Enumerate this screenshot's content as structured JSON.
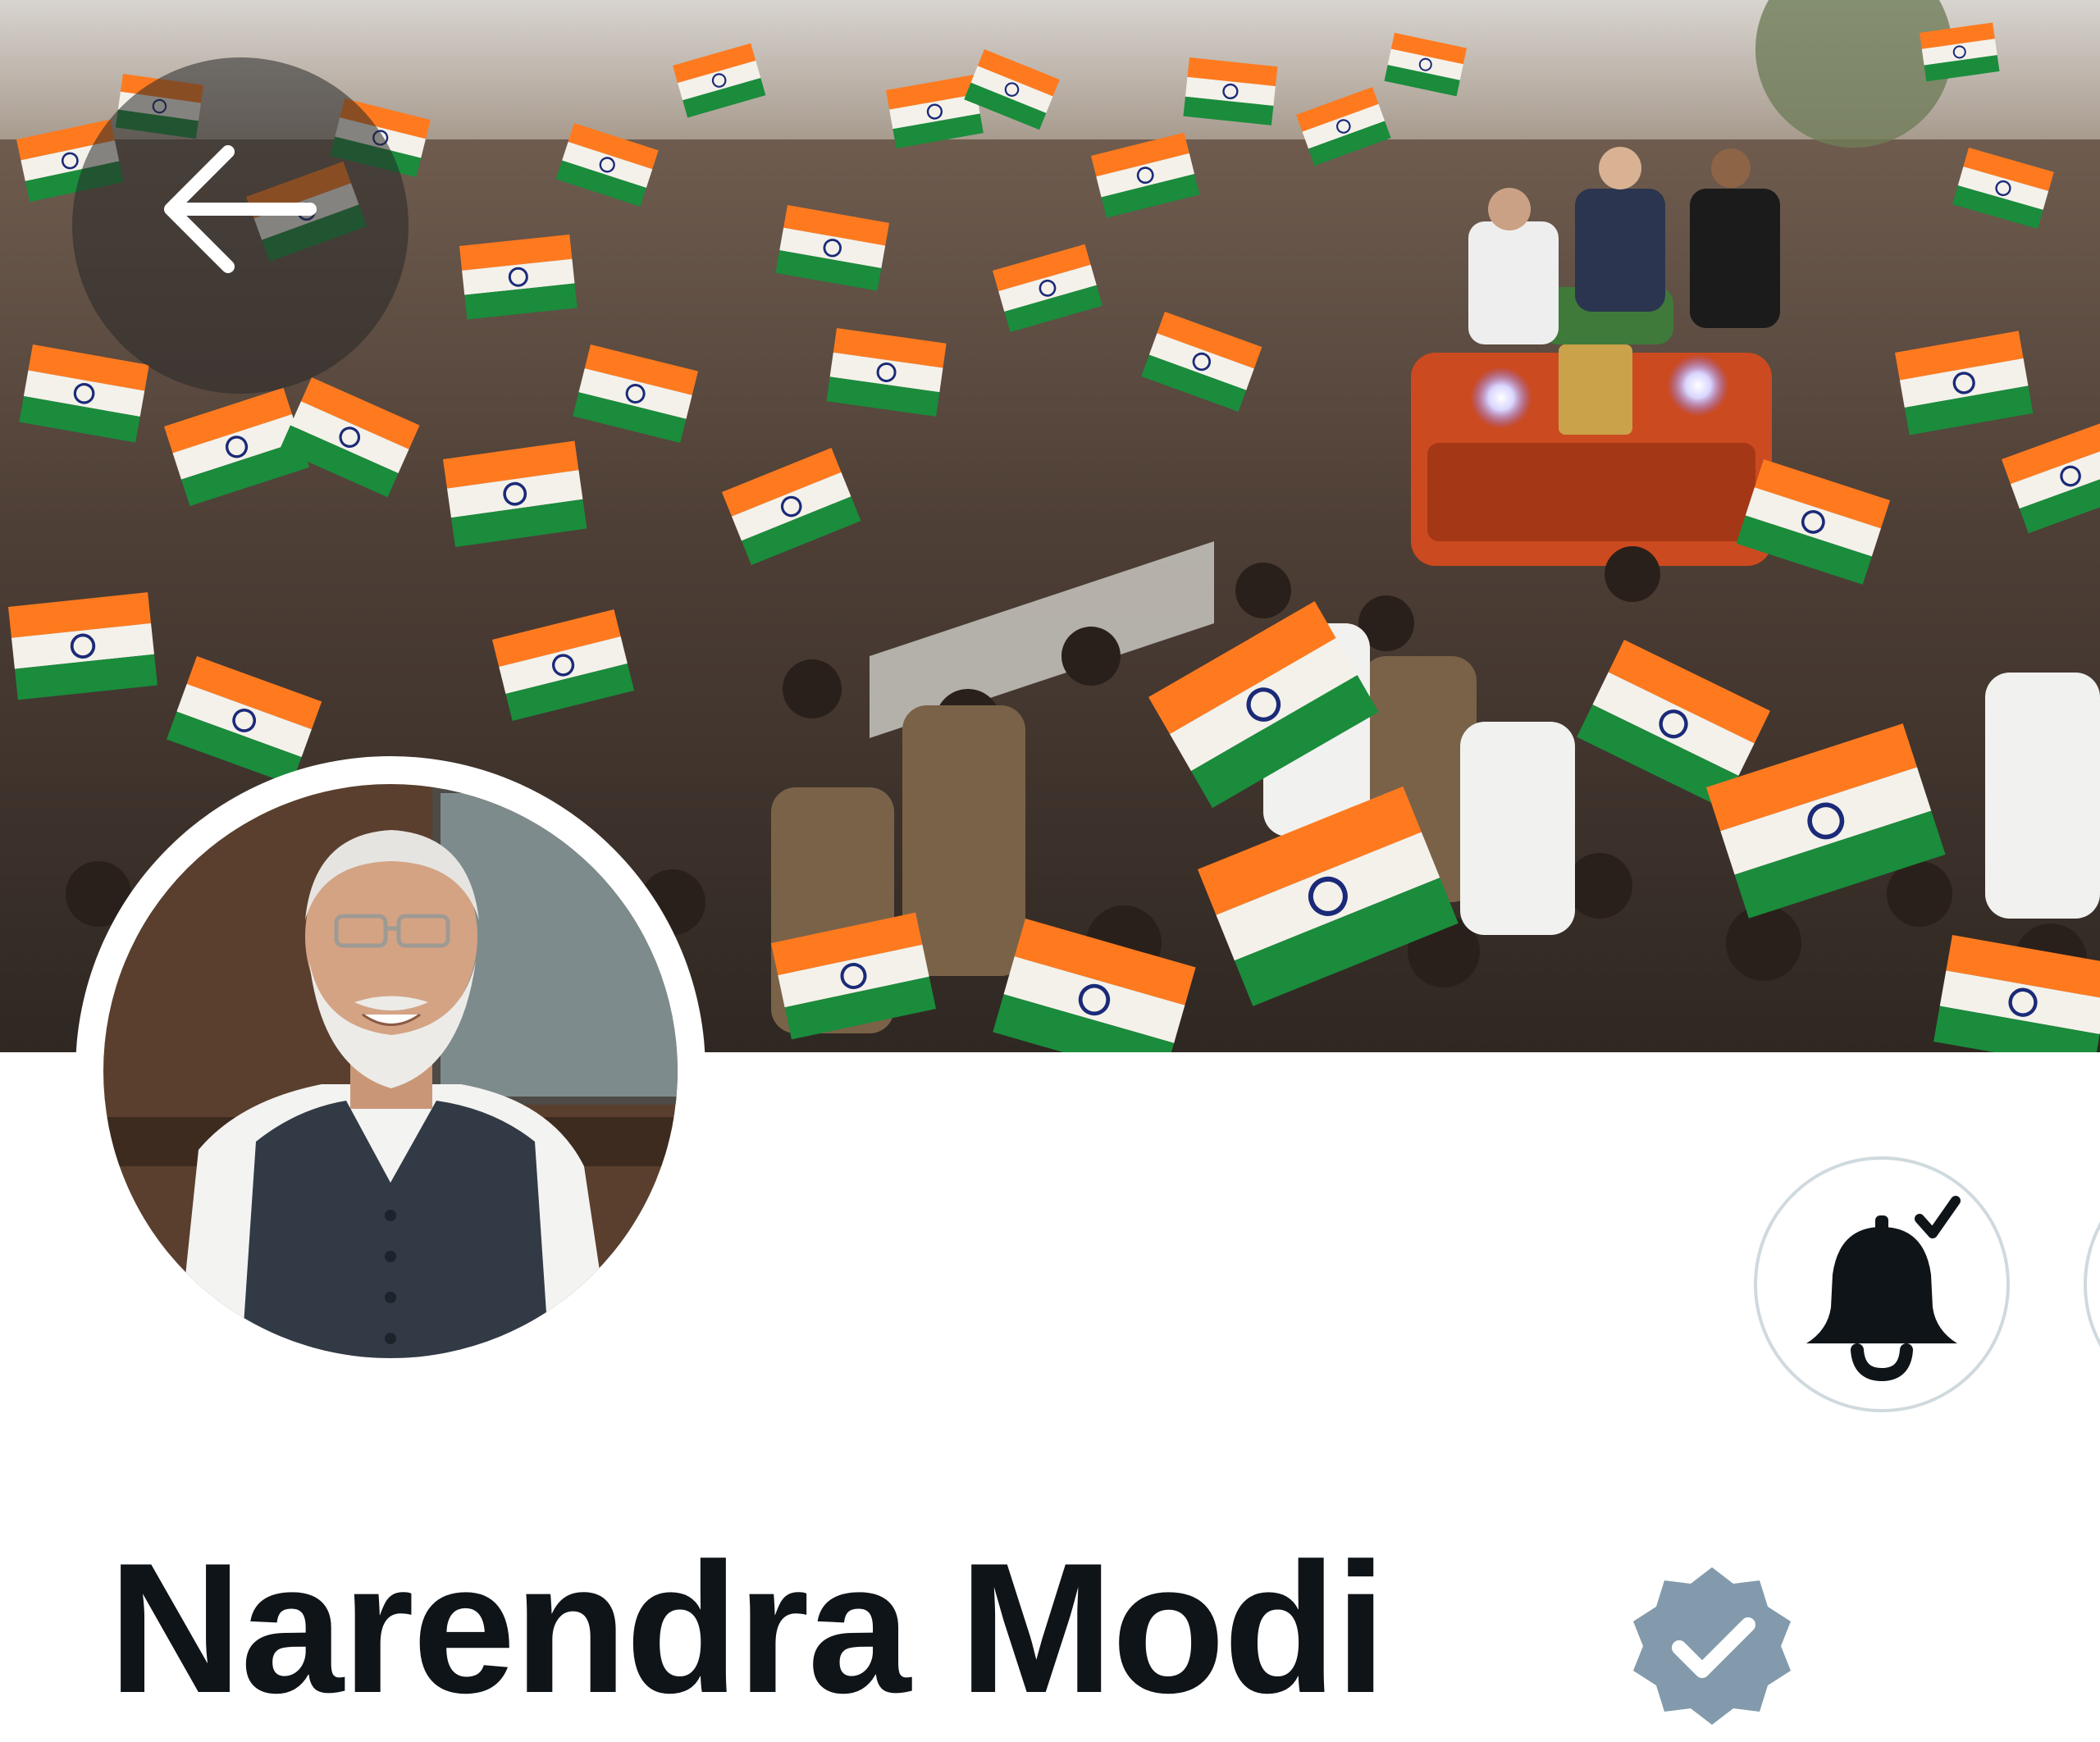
{
  "profile": {
    "display_name": "Narendra Modi",
    "verified": true,
    "verified_badge_color": "#829aab"
  },
  "header": {
    "back_icon": "arrow-left-icon"
  },
  "actions": {
    "notifications_icon": "bell-check-icon",
    "notifications_state": "subscribed"
  },
  "colors": {
    "saffron": "#ff7a1f",
    "green": "#1a8c3c",
    "name_text": "#0f1419",
    "button_border": "#cfd9de"
  }
}
